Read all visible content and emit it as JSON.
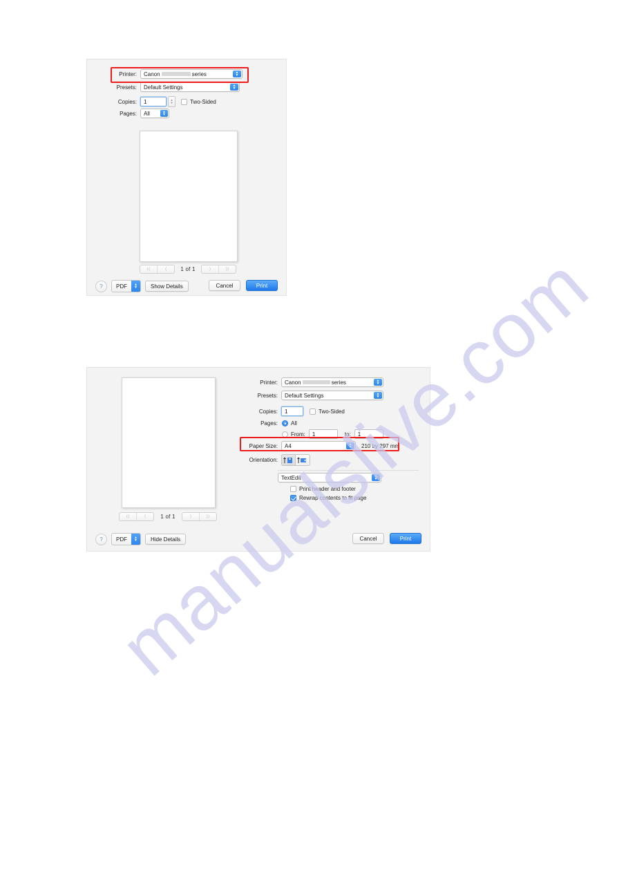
{
  "page": {
    "background": "#ffffff",
    "watermark_text": "manualslive.com",
    "watermark_color": "#c9c9ee",
    "highlight_color": "#ee1b1b",
    "accent_blue": "#2e85ee"
  },
  "dialog1": {
    "name": "print-dialog-collapsed",
    "printer": {
      "label": "Printer:",
      "value_prefix": "Canon",
      "value_suffix": "series",
      "redacted": true
    },
    "presets": {
      "label": "Presets:",
      "value": "Default Settings"
    },
    "copies": {
      "label": "Copies:",
      "value": "1"
    },
    "two_sided": {
      "label": "Two-Sided",
      "checked": false
    },
    "pages": {
      "label": "Pages:",
      "value": "All"
    },
    "pager": {
      "first": "⟨⟨",
      "prev": "⟨",
      "page_label": "1 of 1",
      "next": "⟩",
      "last": "⟩⟩"
    },
    "buttons": {
      "help": "?",
      "pdf": "PDF",
      "details": "Show Details",
      "cancel": "Cancel",
      "print": "Print"
    }
  },
  "dialog2": {
    "name": "print-dialog-expanded",
    "printer": {
      "label": "Printer:",
      "value_prefix": "Canon",
      "value_suffix": "series",
      "redacted": true
    },
    "presets": {
      "label": "Presets:",
      "value": "Default Settings"
    },
    "copies": {
      "label": "Copies:",
      "value": "1"
    },
    "two_sided": {
      "label": "Two-Sided",
      "checked": false
    },
    "pages": {
      "label": "Pages:",
      "all_label": "All",
      "all_selected": true,
      "from_label": "From:",
      "from_value": "1",
      "to_label": "to:",
      "to_value": "1"
    },
    "paper_size": {
      "label": "Paper Size:",
      "value": "A4",
      "dimensions": "210 by 297 mm"
    },
    "orientation": {
      "label": "Orientation:",
      "portrait_selected": true
    },
    "app_panel": {
      "value": "TextEdit"
    },
    "print_header_footer": {
      "label": "Print header and footer",
      "checked": false
    },
    "rewrap": {
      "label": "Rewrap contents to fit page",
      "checked": true
    },
    "pager": {
      "first": "⟨⟨",
      "prev": "⟨",
      "page_label": "1 of 1",
      "next": "⟩",
      "last": "⟩⟩"
    },
    "buttons": {
      "help": "?",
      "pdf": "PDF",
      "details": "Hide Details",
      "cancel": "Cancel",
      "print": "Print"
    }
  }
}
